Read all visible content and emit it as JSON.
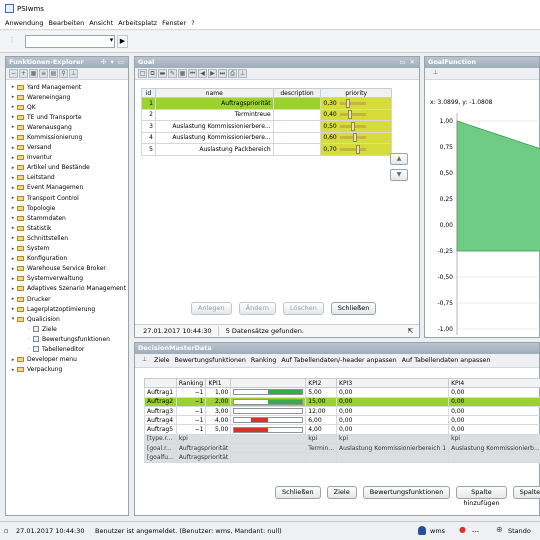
{
  "window": {
    "title": "PSIwms"
  },
  "menu": [
    "Anwendung",
    "Bearbeiten",
    "Ansicht",
    "Arbeitsplatz",
    "Fenster",
    "?"
  ],
  "explorer": {
    "title": "Funktionen-Explorer",
    "items": [
      {
        "label": "Yard Management",
        "type": "folder"
      },
      {
        "label": "Wareneingang",
        "type": "folder"
      },
      {
        "label": "QK",
        "type": "folder"
      },
      {
        "label": "TE und Transporte",
        "type": "folder"
      },
      {
        "label": "Warenausgang",
        "type": "folder"
      },
      {
        "label": "Kommissionierung",
        "type": "folder"
      },
      {
        "label": "Versand",
        "type": "folder"
      },
      {
        "label": "Inventur",
        "type": "folder"
      },
      {
        "label": "Artikel und Bestände",
        "type": "folder"
      },
      {
        "label": "Leitstand",
        "type": "folder"
      },
      {
        "label": "Event Managemen",
        "type": "folder"
      },
      {
        "label": "Transport Control",
        "type": "folder"
      },
      {
        "label": "Topologie",
        "type": "folder"
      },
      {
        "label": "Stammdaten",
        "type": "folder"
      },
      {
        "label": "Statistik",
        "type": "folder"
      },
      {
        "label": "Schnittstellen",
        "type": "folder"
      },
      {
        "label": "System",
        "type": "folder"
      },
      {
        "label": "Konfiguration",
        "type": "folder"
      },
      {
        "label": "Warehouse Service Broker",
        "type": "folder"
      },
      {
        "label": "Systemverwaltung",
        "type": "folder"
      },
      {
        "label": "Adaptives Szenario Management",
        "type": "folder"
      },
      {
        "label": "Drucker",
        "type": "folder"
      },
      {
        "label": "Lagerplatzoptimierung",
        "type": "folder"
      },
      {
        "label": "Qualicision",
        "type": "folder",
        "expanded": true
      },
      {
        "label": "Ziele",
        "type": "leaf",
        "level": 1
      },
      {
        "label": "Bewertungsfunktionen",
        "type": "leaf",
        "level": 1
      },
      {
        "label": "Tabelleneditor",
        "type": "leaf",
        "level": 1
      },
      {
        "label": "Developer menu",
        "type": "folder"
      },
      {
        "label": "Verpackung",
        "type": "folder"
      }
    ]
  },
  "goal": {
    "title": "Goal",
    "columns": [
      "id",
      "name",
      "description",
      "priority"
    ],
    "rows": [
      {
        "id": "1",
        "name": "Auftragspriorität",
        "description": "",
        "priority": "0,30",
        "level": 0.3
      },
      {
        "id": "2",
        "name": "Termintreue",
        "description": "",
        "priority": "0,40",
        "level": 0.4
      },
      {
        "id": "3",
        "name": "Auslastung Kommissionierbere...",
        "description": "",
        "priority": "0,50",
        "level": 0.5
      },
      {
        "id": "4",
        "name": "Auslastung Kommissionierbere...",
        "description": "",
        "priority": "0,60",
        "level": 0.6
      },
      {
        "id": "5",
        "name": "Auslastung Packbereich",
        "description": "",
        "priority": "0,70",
        "level": 0.7
      }
    ],
    "buttons": {
      "new": "Anlegen",
      "change": "Ändern",
      "delete": "Löschen",
      "close": "Schließen"
    },
    "status": {
      "timestamp": "27.01.2017 10:44:30",
      "message": "5 Datensätze gefunden."
    }
  },
  "goalfunction": {
    "title": "GoalFunction",
    "coords": "x: 3.0899, y: -1.0808",
    "yticks": [
      "1,00",
      "0,75",
      "0,50",
      "0,25",
      "0,00",
      "-0,25",
      "-0,50",
      "-0,75",
      "-1,00"
    ]
  },
  "dmd": {
    "title": "DecisionMasterData",
    "toolbar": [
      "Ziele",
      "Bewertungsfunktionen",
      "Ranking",
      "Auf Tabellendaten/-header anpassen",
      "Auf Tabellendaten anpassen"
    ],
    "header": [
      "",
      "Ranking",
      "KPI1",
      "",
      "KPI2",
      "KPI3",
      "KPI4"
    ],
    "rows": [
      {
        "name": "Auftrag1",
        "rank": "−1",
        "kpi1": "1,00",
        "kpi2": "5,00",
        "kpi3": "0,00",
        "kpi4": "0,00",
        "fill": 0.5,
        "color": "#3aa94a",
        "start": 0.5
      },
      {
        "name": "Auftrag2",
        "rank": "−1",
        "kpi1": "2,00",
        "kpi2": "15,00",
        "kpi3": "0,00",
        "kpi4": "0,00",
        "fill": 0.5,
        "color": "#3aa94a",
        "start": 0.5
      },
      {
        "name": "Auftrag3",
        "rank": "−1",
        "kpi1": "3,00",
        "kpi2": "12,00",
        "kpi3": "0,00",
        "kpi4": "0,00",
        "fill": 0,
        "color": "#3aa94a",
        "start": 0.5
      },
      {
        "name": "Auftrag4",
        "rank": "−1",
        "kpi1": "4,00",
        "kpi2": "6,00",
        "kpi3": "0,00",
        "kpi4": "0,00",
        "fill": 0.25,
        "color": "#d9302a",
        "start": 0.25
      },
      {
        "name": "Auftrag5",
        "rank": "−1",
        "kpi1": "5,00",
        "kpi2": "4,00",
        "kpi3": "0,00",
        "kpi4": "0,00",
        "fill": 0.5,
        "color": "#d9302a",
        "start": 0
      }
    ],
    "meta": [
      [
        "[type.r...",
        "kpi",
        "",
        "kpi",
        "kpi",
        "kpi"
      ],
      [
        "[goal.r...",
        "Auftragspriorität",
        "",
        "Termin...",
        "Auslastung Kommissionierbereich 1",
        "Auslastung Kommissionierb..."
      ],
      [
        "[goalfu...",
        "Auftragspriorität",
        "",
        "",
        "",
        ""
      ]
    ],
    "buttons": [
      "Schließen",
      "Ziele",
      "Bewertungsfunktionen",
      "Spalte hinzufügen",
      "Spalte"
    ]
  },
  "statusbar": {
    "timestamp": "27.01.2017 10:44:30",
    "message": "Benutzer ist angemeldet. (Benutzer: wms, Mandant: null)",
    "user": "wms",
    "location": "---",
    "site": "Stando"
  },
  "colors": {
    "selection": "#9bd22e",
    "priority": "#d6dc3a",
    "chart_fill": "#69c97f",
    "header": "#a9b6c3"
  }
}
